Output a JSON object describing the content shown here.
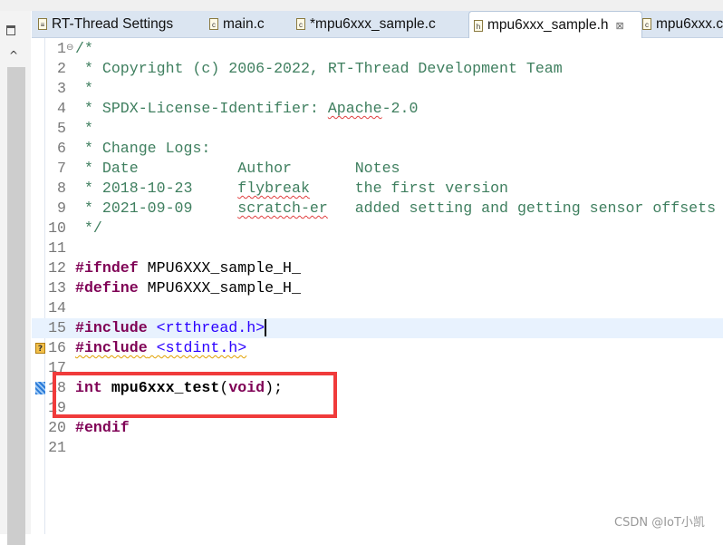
{
  "tabs": [
    {
      "label": "RT-Thread Settings",
      "icon": "settings-file-icon",
      "active": false
    },
    {
      "label": "main.c",
      "icon": "c-file-icon",
      "active": false
    },
    {
      "label": "*mpu6xxx_sample.c",
      "icon": "c-file-icon",
      "active": false
    },
    {
      "label": "mpu6xxx_sample.h",
      "icon": "h-file-icon",
      "active": true,
      "close": "⊠"
    },
    {
      "label": "mpu6xxx.c",
      "icon": "c-file-icon",
      "active": false
    }
  ],
  "editor": {
    "current_line": 15,
    "lines": [
      {
        "n": "1",
        "segs": [
          {
            "t": "/*",
            "c": "cm"
          }
        ]
      },
      {
        "n": "2",
        "segs": [
          {
            "t": " * Copyright (c) 2006-2022, RT-Thread Development Team",
            "c": "cm"
          }
        ]
      },
      {
        "n": "3",
        "segs": [
          {
            "t": " *",
            "c": "cm"
          }
        ]
      },
      {
        "n": "4",
        "segs": [
          {
            "t": " * SPDX-License-Identifier: ",
            "c": "cm"
          },
          {
            "t": "Apache",
            "c": "cm und red"
          },
          {
            "t": "-2.0",
            "c": "cm"
          }
        ]
      },
      {
        "n": "5",
        "segs": [
          {
            "t": " *",
            "c": "cm"
          }
        ]
      },
      {
        "n": "6",
        "segs": [
          {
            "t": " * Change Logs:",
            "c": "cm"
          }
        ]
      },
      {
        "n": "7",
        "segs": [
          {
            "t": " * Date           Author       Notes",
            "c": "cm"
          }
        ]
      },
      {
        "n": "8",
        "segs": [
          {
            "t": " * 2018-10-23     ",
            "c": "cm"
          },
          {
            "t": "flybreak",
            "c": "cm und red"
          },
          {
            "t": "     the first version",
            "c": "cm"
          }
        ]
      },
      {
        "n": "9",
        "segs": [
          {
            "t": " * 2021-09-09     ",
            "c": "cm"
          },
          {
            "t": "scratch-er",
            "c": "cm und red"
          },
          {
            "t": "   added setting and getting sensor offsets",
            "c": "cm"
          }
        ]
      },
      {
        "n": "10",
        "segs": [
          {
            "t": " */",
            "c": "cm"
          }
        ]
      },
      {
        "n": "11",
        "segs": []
      },
      {
        "n": "12",
        "segs": [
          {
            "t": "#ifndef",
            "c": "kw"
          },
          {
            "t": " MPU6XXX_sample_H_",
            "c": "pl"
          }
        ]
      },
      {
        "n": "13",
        "segs": [
          {
            "t": "#define",
            "c": "kw"
          },
          {
            "t": " MPU6XXX_sample_H_",
            "c": "pl"
          }
        ]
      },
      {
        "n": "14",
        "segs": []
      },
      {
        "n": "15",
        "segs": [
          {
            "t": "#include",
            "c": "kw"
          },
          {
            "t": " <rtthread.h>",
            "c": "inc"
          }
        ]
      },
      {
        "n": "16",
        "segs": [
          {
            "t": "#include",
            "c": "kw und"
          },
          {
            "t": " <stdint.h>",
            "c": "inc und"
          }
        ]
      },
      {
        "n": "17",
        "segs": []
      },
      {
        "n": "18",
        "segs": [
          {
            "t": "int",
            "c": "kw"
          },
          {
            "t": " ",
            "c": "pl"
          },
          {
            "t": "mpu6xxx_test",
            "c": "fn"
          },
          {
            "t": "(",
            "c": "pl"
          },
          {
            "t": "void",
            "c": "kw"
          },
          {
            "t": ");",
            "c": "pl"
          }
        ]
      },
      {
        "n": "19",
        "segs": []
      },
      {
        "n": "20",
        "segs": [
          {
            "t": "#endif",
            "c": "kw"
          }
        ]
      },
      {
        "n": "21",
        "segs": []
      }
    ],
    "warning_marker": {
      "line": 16,
      "glyph": "?"
    },
    "bookmark_line": 18,
    "fold_marker_line": 1,
    "fold_glyph": "⊖"
  },
  "highlight_color": "#f03b3b",
  "watermark": "CSDN @IoT小凯"
}
